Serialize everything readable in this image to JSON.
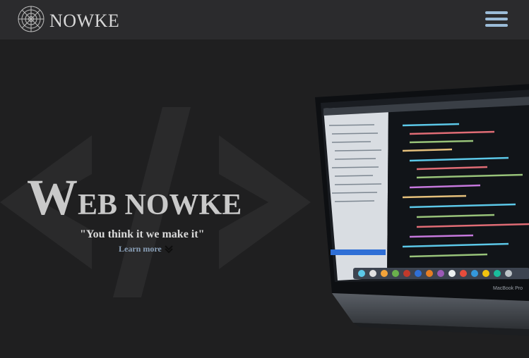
{
  "header": {
    "brand_name": "NOWKE",
    "menu_icon": "hamburger-menu-icon",
    "logo_icon": "spiderweb-logo-icon",
    "menu_color": "#9bbcd8"
  },
  "hero": {
    "title_initial": "W",
    "title_rest": "EB NOWKE",
    "tagline": "\"You think it we make it\"",
    "cta_label": "Learn more",
    "cta_icon": "double-chevron-down-icon",
    "laptop_brand": "MacBook Pro"
  }
}
